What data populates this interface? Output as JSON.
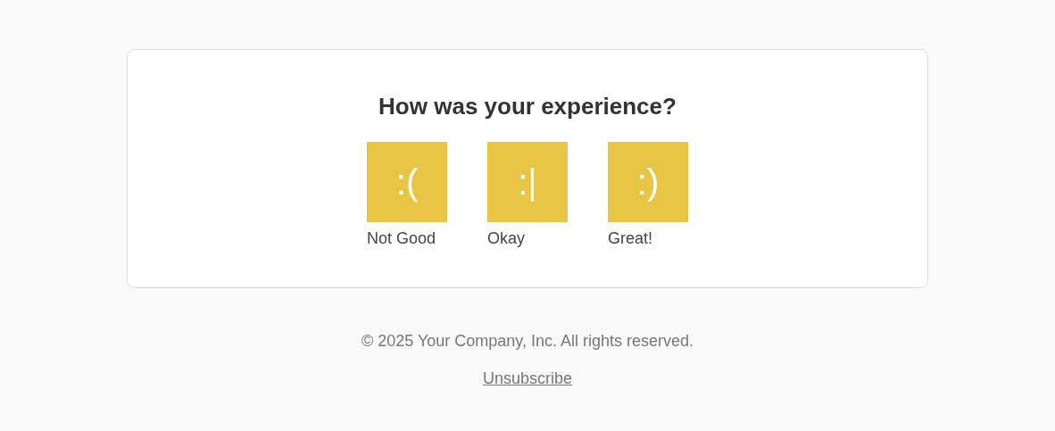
{
  "card": {
    "title": "How was your experience?",
    "options": [
      {
        "emoticon": ":(",
        "label": "Not Good"
      },
      {
        "emoticon": ":|",
        "label": "Okay"
      },
      {
        "emoticon": ":)",
        "label": "Great!"
      }
    ]
  },
  "footer": {
    "copyright": "© 2025 Your Company, Inc. All rights reserved.",
    "unsubscribe": "Unsubscribe"
  }
}
